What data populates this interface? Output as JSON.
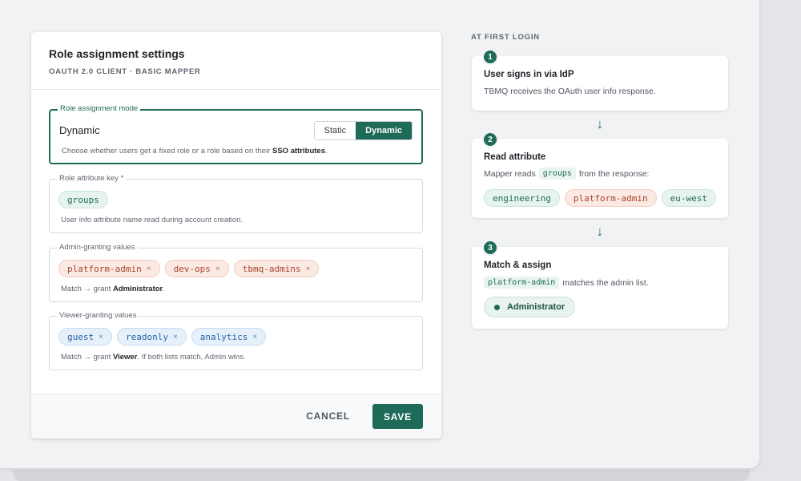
{
  "dialog": {
    "title": "Role assignment settings",
    "subtitle": "OAUTH 2.0 CLIENT · BASIC MAPPER",
    "mode": {
      "legend": "Role assignment mode",
      "value": "Dynamic",
      "options": [
        "Static",
        "Dynamic"
      ],
      "selected": "Dynamic",
      "help_prefix": "Choose whether users get a fixed role or a role based on their ",
      "help_bold": "SSO attributes",
      "help_suffix": "."
    },
    "attribute_key": {
      "legend": "Role attribute key *",
      "chip": "groups",
      "help": "User info attribute name read during account creation."
    },
    "admin_values": {
      "legend": "Admin-granting values",
      "chips": [
        "platform-admin",
        "dev-ops",
        "tbmq-admins"
      ],
      "help_prefix": "Match → grant ",
      "help_bold": "Administrator",
      "help_suffix": "."
    },
    "viewer_values": {
      "legend": "Viewer-granting values",
      "chips": [
        "guest",
        "readonly",
        "analytics"
      ],
      "help_prefix": "Match → grant ",
      "help_bold": "Viewer",
      "help_suffix": ". If both lists match, Admin wins."
    },
    "footer": {
      "cancel_label": "CANCEL",
      "save_label": "SAVE"
    }
  },
  "flow": {
    "heading": "AT FIRST LOGIN",
    "steps": [
      {
        "number": "1",
        "title": "User signs in via IdP",
        "text": "TBMQ receives the OAuth user info response."
      },
      {
        "number": "2",
        "title": "Read attribute",
        "text_prefix": "Mapper reads",
        "code": "groups",
        "text_suffix": "from the response:",
        "chips": [
          "engineering",
          "platform-admin",
          "eu-west"
        ]
      },
      {
        "number": "3",
        "title": "Match & assign",
        "code": "platform-admin",
        "text_suffix": "matches the admin list.",
        "result": "Administrator"
      }
    ]
  },
  "icons": {
    "remove": "×",
    "arrow": "↓"
  },
  "colors": {
    "accent": "#1f6b5a",
    "admin_chip": "#a8452c",
    "viewer_chip": "#2b62a6"
  }
}
